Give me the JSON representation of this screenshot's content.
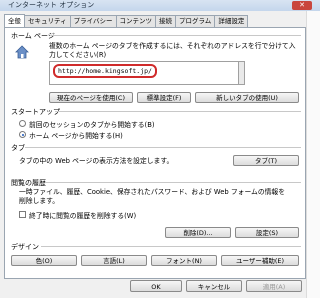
{
  "window": {
    "title": "インターネット オプション",
    "close_label": "✕"
  },
  "tabs": [
    {
      "label": "全般",
      "active": true
    },
    {
      "label": "セキュリティ"
    },
    {
      "label": "プライバシー"
    },
    {
      "label": "コンテンツ"
    },
    {
      "label": "接続"
    },
    {
      "label": "プログラム"
    },
    {
      "label": "詳細設定"
    }
  ],
  "home": {
    "section_label": "ホーム ページ",
    "description_line1": "複数のホーム ページのタブを作成するには、それぞれのアドレスを行で分けて入",
    "description_line2": "力してください(R)",
    "url": "http://home.kingsoft.jp/",
    "btn_current": "現在のページを使用(C)",
    "btn_default": "標準設定(F)",
    "btn_new_tab": "新しいタブの使用(U)"
  },
  "startup": {
    "section_label": "スタートアップ",
    "option_prev": "前回のセッションのタブから開始する(B)",
    "option_home": "ホーム ページから開始する(H)",
    "selected": "home"
  },
  "tabsec": {
    "section_label": "タブ",
    "description": "タブの中の Web ページの表示方法を設定します。",
    "btn_tabs": "タブ(T)"
  },
  "history": {
    "section_label": "閲覧の履歴",
    "description_line1": "一時ファイル、履歴、Cookie、保存されたパスワード、および Web フォームの情報を",
    "description_line2": "削除します。",
    "checkbox_label": "終了時に閲覧の履歴を削除する(W)",
    "checked": false,
    "btn_delete": "削除(D)...",
    "btn_settings": "設定(S)"
  },
  "design": {
    "section_label": "デザイン",
    "btn_colors": "色(O)",
    "btn_languages": "言語(L)",
    "btn_fonts": "フォント(N)",
    "btn_accessibility": "ユーザー補助(E)"
  },
  "footer": {
    "ok": "OK",
    "cancel": "キャンセル",
    "apply": "適用(A)"
  }
}
